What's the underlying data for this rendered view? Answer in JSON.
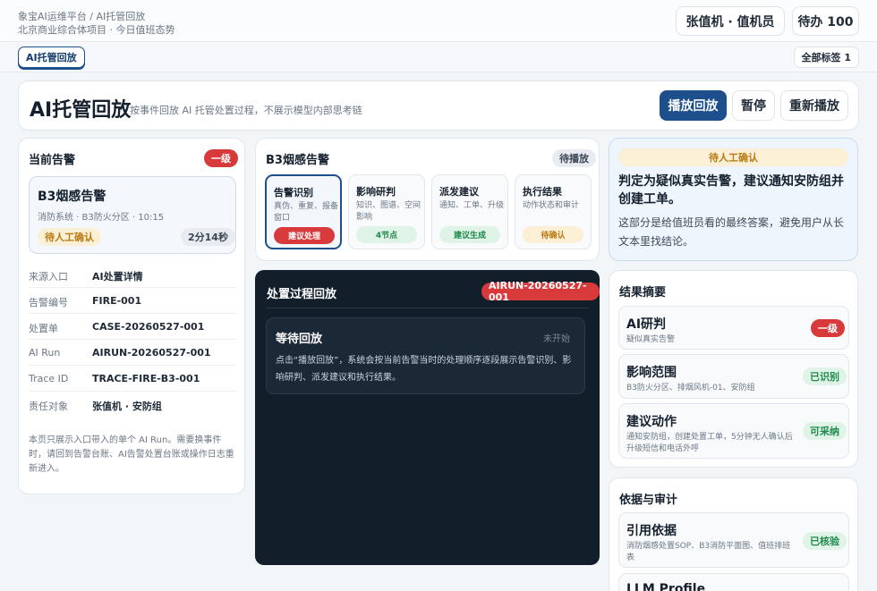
{
  "topbar": {
    "breadcrumb": "象宝AI运维平台 / AI托管回放",
    "context": "北京商业综合体项目 · 今日值班态势",
    "user": "张值机 · 值机员",
    "todo": "待办 100"
  },
  "tabs": {
    "active": "AI托管回放",
    "all_tags": "全部标签 1"
  },
  "header": {
    "title": "AI托管回放",
    "subtitle": "按事件回放 AI 托管处置过程，不展示模型内部思考链",
    "play": "播放回放",
    "pause": "暂停",
    "replay": "重新播放"
  },
  "alert": {
    "section_title": "当前告警",
    "level": "一级",
    "name": "B3烟感告警",
    "meta": "消防系统 · B3防火分区 · 10:15",
    "status": "待人工确认",
    "elapsed": "2分14秒",
    "fields": [
      {
        "k": "来源入口",
        "v": "AI处置详情"
      },
      {
        "k": "告警编号",
        "v": "FIRE-001"
      },
      {
        "k": "处置单",
        "v": "CASE-20260527-001"
      },
      {
        "k": "AI Run",
        "v": "AIRUN-20260527-001"
      },
      {
        "k": "Trace ID",
        "v": "TRACE-FIRE-B3-001"
      },
      {
        "k": "责任对象",
        "v": "张值机 · 安防组"
      }
    ],
    "note": "本页只展示入口带入的单个 AI Run。需要换事件时，请回到告警台账、AI告警处置台账或操作日志重新进入。"
  },
  "steps": {
    "title": "B3烟感告警",
    "status": "待播放",
    "items": [
      {
        "title": "告警识别",
        "desc": "真伪、重复、报备窗口",
        "badge": "建议处理"
      },
      {
        "title": "影响研判",
        "desc": "知识、图谱、空间影响",
        "badge": "4节点"
      },
      {
        "title": "派发建议",
        "desc": "通知、工单、升级",
        "badge": "建议生成"
      },
      {
        "title": "执行结果",
        "desc": "动作状态和审计",
        "badge": "待确认"
      }
    ]
  },
  "playback": {
    "title": "处置过程回放",
    "run_id": "AIRUN-20260527-001",
    "wait_title": "等待回放",
    "wait_status": "未开始",
    "wait_desc": "点击“播放回放”，系统会按当前告警当时的处理顺序逐段展示告警识别、影响研判、派发建议和执行结果。"
  },
  "conclusion": {
    "tag": "待人工确认",
    "headline": "判定为疑似真实告警，建议通知安防组并创建工单。",
    "desc": "这部分是给值班员看的最终答案，避免用户从长文本里找结论。"
  },
  "summary": {
    "title": "结果摘要",
    "items": [
      {
        "title": "AI研判",
        "desc": "疑似真实告警",
        "badge": "一级"
      },
      {
        "title": "影响范围",
        "desc": "B3防火分区、排烟风机-01、安防组",
        "badge": "已识别"
      },
      {
        "title": "建议动作",
        "desc": "通知安防组，创建处置工单，5分钟无人确认后升级短信和电话外呼",
        "badge": "可采纳"
      }
    ]
  },
  "evidence": {
    "title": "依据与审计",
    "items": [
      {
        "title": "引用依据",
        "desc": "消防烟感处置SOP、B3消防平面图、值班排班表",
        "badge": "已核验"
      },
      {
        "title": "LLM Profile"
      }
    ]
  }
}
